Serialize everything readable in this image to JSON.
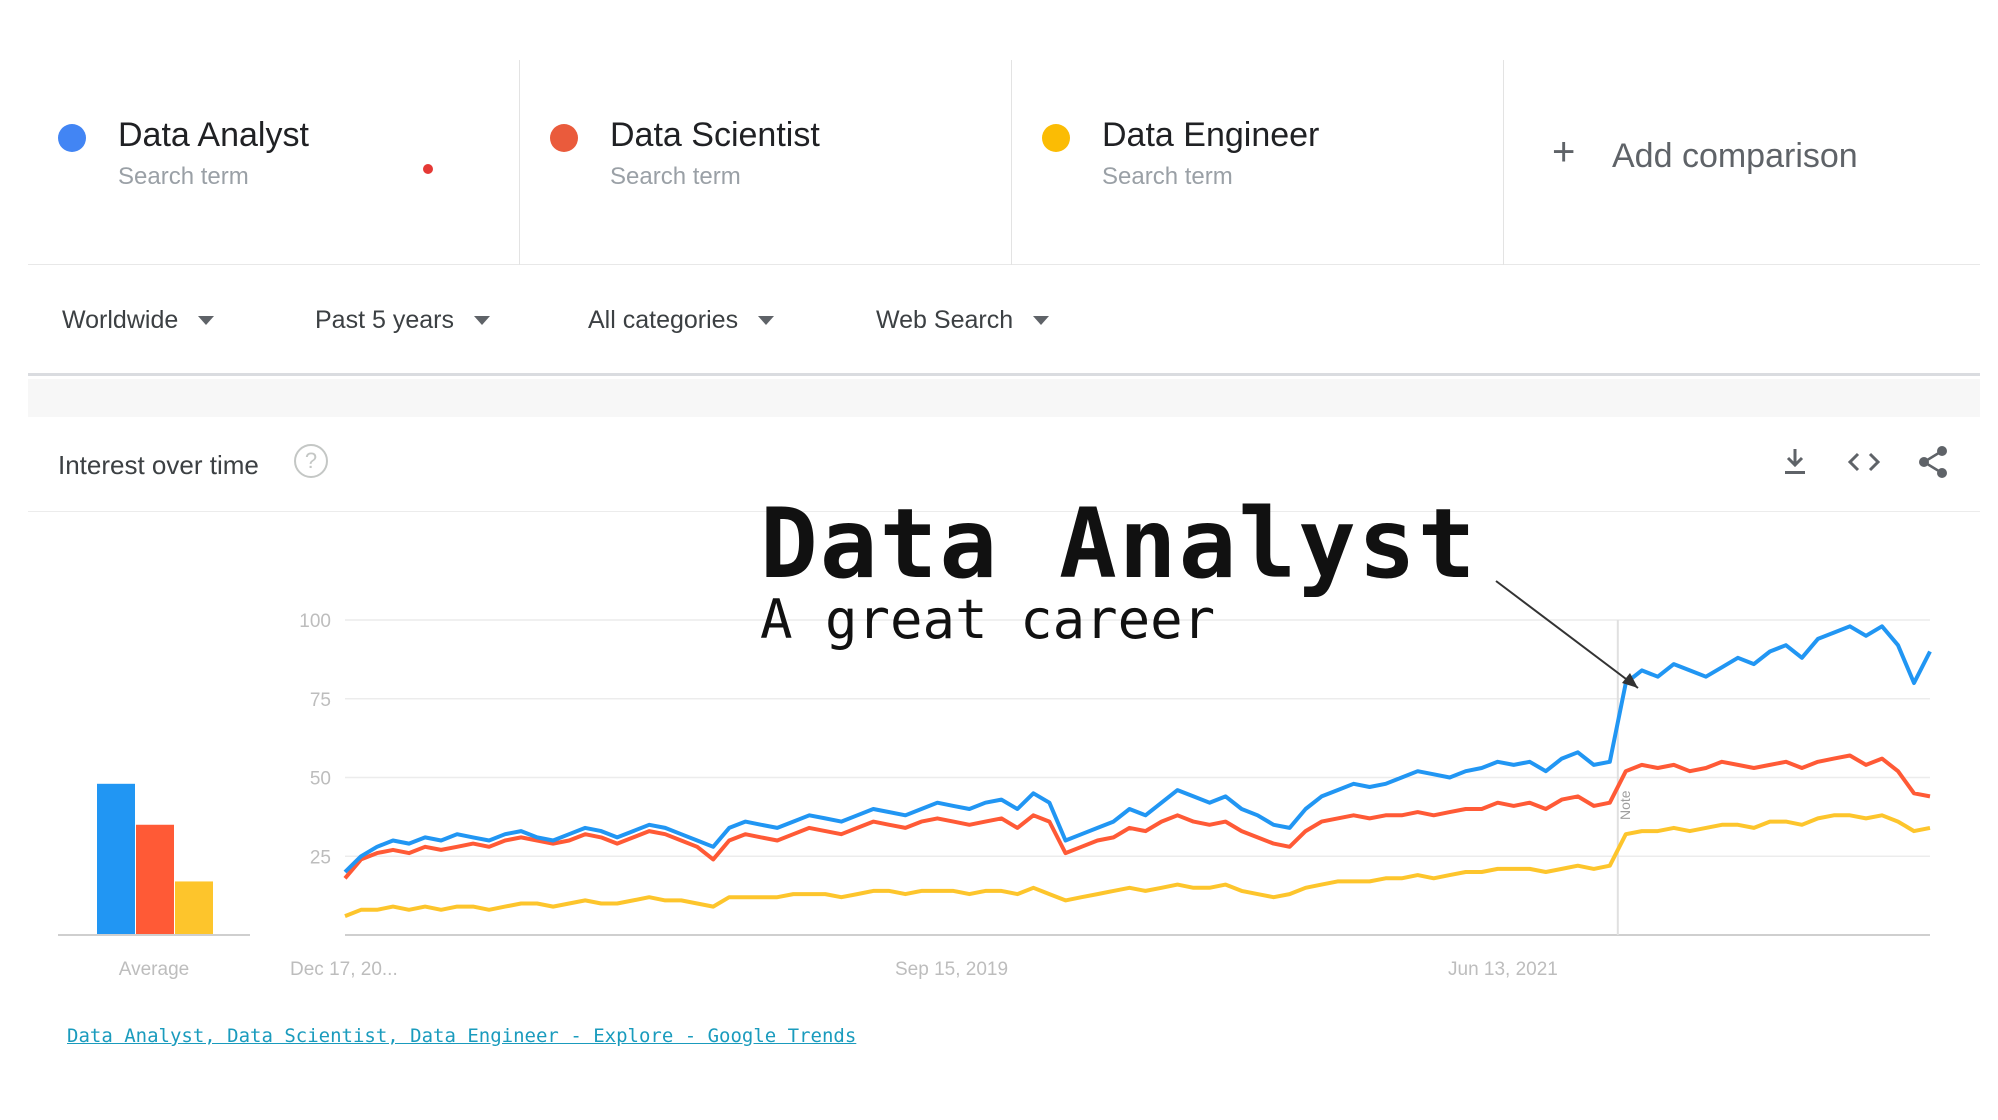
{
  "terms": [
    {
      "name": "Data Analyst",
      "sub": "Search term",
      "color": "#4285f4"
    },
    {
      "name": "Data Scientist",
      "sub": "Search term",
      "color": "#ea5b3c"
    },
    {
      "name": "Data Engineer",
      "sub": "Search term",
      "color": "#fbbc04"
    }
  ],
  "add_comparison": {
    "icon": "plus-icon",
    "label": "Add comparison"
  },
  "filters": {
    "region": "Worldwide",
    "time": "Past 5 years",
    "category": "All categories",
    "search_type": "Web Search"
  },
  "card": {
    "title": "Interest over time",
    "help_icon": "help-circle-icon",
    "tools": [
      "download-icon",
      "embed-code-icon",
      "share-icon"
    ]
  },
  "overlay": {
    "title": "Data Analyst",
    "subtitle": "A great career"
  },
  "footer_link": "Data Analyst, Data Scientist, Data Engineer - Explore - Google Trends",
  "chart_data": {
    "type": "line",
    "title": "",
    "xlabel": "",
    "ylabel": "",
    "ylim": [
      0,
      100
    ],
    "yticks": [
      25,
      50,
      75,
      100
    ],
    "xtick_labels": [
      "Dec 17, 20...",
      "Sep 15, 2019",
      "Jun 13, 2021"
    ],
    "annotation": "Note",
    "grid": true,
    "average_bars": {
      "label": "Average",
      "values": [
        48,
        35,
        17
      ],
      "colors": [
        "#2196f3",
        "#ff5a36",
        "#fdc52c"
      ]
    },
    "series": [
      {
        "name": "Data Analyst",
        "color": "#2196f3",
        "values": [
          20,
          25,
          28,
          30,
          29,
          31,
          30,
          32,
          31,
          30,
          32,
          33,
          31,
          30,
          32,
          34,
          33,
          31,
          33,
          35,
          34,
          32,
          30,
          28,
          34,
          36,
          35,
          34,
          36,
          38,
          37,
          36,
          38,
          40,
          39,
          38,
          40,
          42,
          41,
          40,
          42,
          43,
          40,
          45,
          42,
          30,
          32,
          34,
          36,
          40,
          38,
          42,
          46,
          44,
          42,
          44,
          40,
          38,
          35,
          34,
          40,
          44,
          46,
          48,
          47,
          48,
          50,
          52,
          51,
          50,
          52,
          53,
          55,
          54,
          55,
          52,
          56,
          58,
          54,
          55,
          80,
          84,
          82,
          86,
          84,
          82,
          85,
          88,
          86,
          90,
          92,
          88,
          94,
          96,
          98,
          95,
          98,
          92,
          80,
          90
        ]
      },
      {
        "name": "Data Scientist",
        "color": "#ff5a36",
        "values": [
          18,
          24,
          26,
          27,
          26,
          28,
          27,
          28,
          29,
          28,
          30,
          31,
          30,
          29,
          30,
          32,
          31,
          29,
          31,
          33,
          32,
          30,
          28,
          24,
          30,
          32,
          31,
          30,
          32,
          34,
          33,
          32,
          34,
          36,
          35,
          34,
          36,
          37,
          36,
          35,
          36,
          37,
          34,
          38,
          36,
          26,
          28,
          30,
          31,
          34,
          33,
          36,
          38,
          36,
          35,
          36,
          33,
          31,
          29,
          28,
          33,
          36,
          37,
          38,
          37,
          38,
          38,
          39,
          38,
          39,
          40,
          40,
          42,
          41,
          42,
          40,
          43,
          44,
          41,
          42,
          52,
          54,
          53,
          54,
          52,
          53,
          55,
          54,
          53,
          54,
          55,
          53,
          55,
          56,
          57,
          54,
          56,
          52,
          45,
          44
        ]
      },
      {
        "name": "Data Engineer",
        "color": "#fdc52c",
        "values": [
          6,
          8,
          8,
          9,
          8,
          9,
          8,
          9,
          9,
          8,
          9,
          10,
          10,
          9,
          10,
          11,
          10,
          10,
          11,
          12,
          11,
          11,
          10,
          9,
          12,
          12,
          12,
          12,
          13,
          13,
          13,
          12,
          13,
          14,
          14,
          13,
          14,
          14,
          14,
          13,
          14,
          14,
          13,
          15,
          13,
          11,
          12,
          13,
          14,
          15,
          14,
          15,
          16,
          15,
          15,
          16,
          14,
          13,
          12,
          13,
          15,
          16,
          17,
          17,
          17,
          18,
          18,
          19,
          18,
          19,
          20,
          20,
          21,
          21,
          21,
          20,
          21,
          22,
          21,
          22,
          32,
          33,
          33,
          34,
          33,
          34,
          35,
          35,
          34,
          36,
          36,
          35,
          37,
          38,
          38,
          37,
          38,
          36,
          33,
          34
        ]
      }
    ]
  }
}
